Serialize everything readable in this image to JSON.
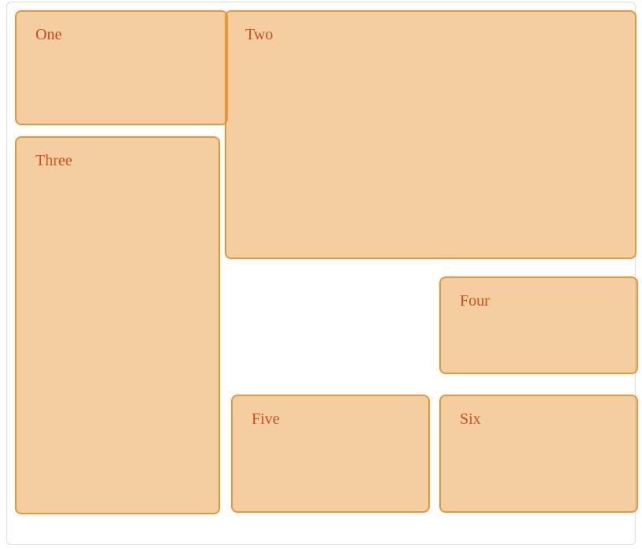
{
  "boxes": {
    "one": "One",
    "two": "Two",
    "three": "Three",
    "four": "Four",
    "five": "Five",
    "six": "Six"
  }
}
